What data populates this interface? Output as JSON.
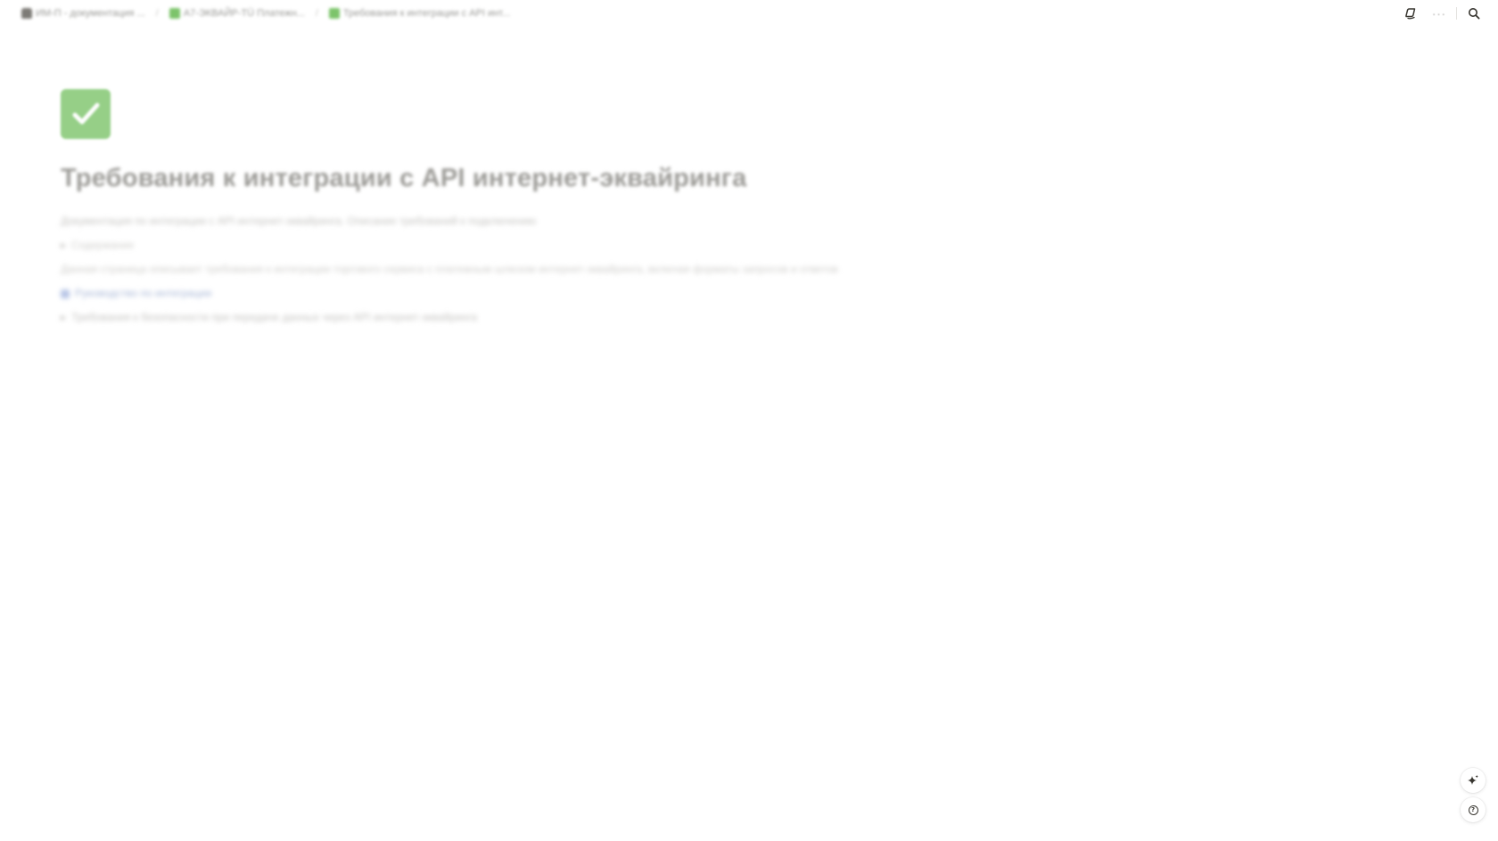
{
  "topbar": {
    "breadcrumb": [
      {
        "label": "ИМ-П - документация ...",
        "icon": "lock-icon"
      },
      {
        "label": "A7-ЭКВАЙР-TÜ Платежн...",
        "icon": "check-box-icon"
      },
      {
        "label": "Требования к интеграции с API инт...",
        "icon": "check-box-icon"
      }
    ],
    "separator": "/",
    "more_label": "···"
  },
  "page": {
    "icon": "check-box-icon",
    "icon_glyph": "✓",
    "title": "Требования к интеграции с API  интернет-эквайринга",
    "lines": [
      "Документация по интеграции с API интернет-эквайринга. Описание требований к подключению",
      "Содержание",
      "Данная страница описывает требования к интеграции торгового сервиса с платежным шлюзом интернет-эквайринга, включая форматы запросов и ответов",
      "Руководство по интеграции",
      "Требования к безопасности при передаче данных через API интернет-эквайринга"
    ]
  },
  "floating": {
    "ai_button": "sparkle-icon",
    "help_button": "?"
  },
  "colors": {
    "accent_green": "#7cc46a",
    "text": "#37352f",
    "muted": "#9a9a97"
  }
}
